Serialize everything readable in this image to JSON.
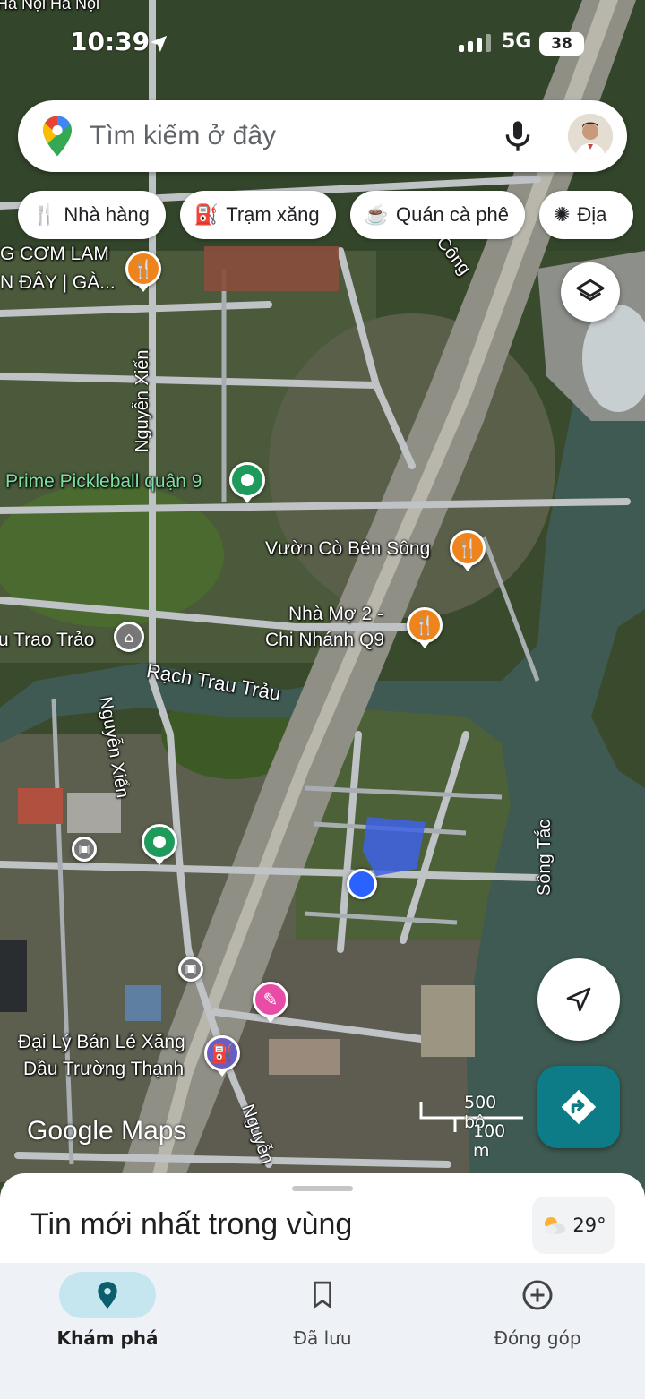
{
  "status": {
    "time": "10:39",
    "network": "5G",
    "battery": "38",
    "top_label": "Hà Nội Hà Nội"
  },
  "search": {
    "placeholder": "Tìm kiếm ở đây"
  },
  "chips": [
    {
      "icon": "restaurant-icon",
      "label": "Nhà hàng"
    },
    {
      "icon": "gas-station-icon",
      "label": "Trạm xăng"
    },
    {
      "icon": "coffee-icon",
      "label": "Quán cà phê"
    },
    {
      "icon": "attractions-icon",
      "label": "Địa"
    }
  ],
  "map_labels": {
    "com_lam_1": "G CƠM LAM",
    "com_lam_2": "N ĐÂY | GÀ...",
    "nguyen_xien_1": "Nguyễn Xiển",
    "nguyen_xien_2": "Nguyễn Xiển",
    "nguyen_xien_3": "Nguyễn",
    "pickleball": "Prime Pickleball quận 9",
    "vuon_co": "Vườn Cò Bên Sông",
    "nha_mo_1": "Nhà Mợ 2 -",
    "nha_mo_2": "Chi Nhánh Q9",
    "trao_trao": "u Trao Trảo",
    "rach_trau": "Rạch Trau Trảu",
    "song_tac": "Sông Tắc",
    "cong": "Công",
    "dai_ly_1": "Đại Lý Bán Lẻ Xăng",
    "dai_ly_2": "Dầu Trường Thạnh",
    "google_maps": "Google Maps"
  },
  "scale": {
    "imperial": "500 bộ",
    "metric": "100 m"
  },
  "sheet": {
    "title": "Tin mới nhất trong vùng"
  },
  "weather": {
    "temp": "29°"
  },
  "nav": [
    {
      "label": "Khám phá",
      "icon": "location-pin-icon",
      "active": true
    },
    {
      "label": "Đã lưu",
      "icon": "bookmark-icon",
      "active": false
    },
    {
      "label": "Đóng góp",
      "icon": "add-circle-icon",
      "active": false
    }
  ]
}
